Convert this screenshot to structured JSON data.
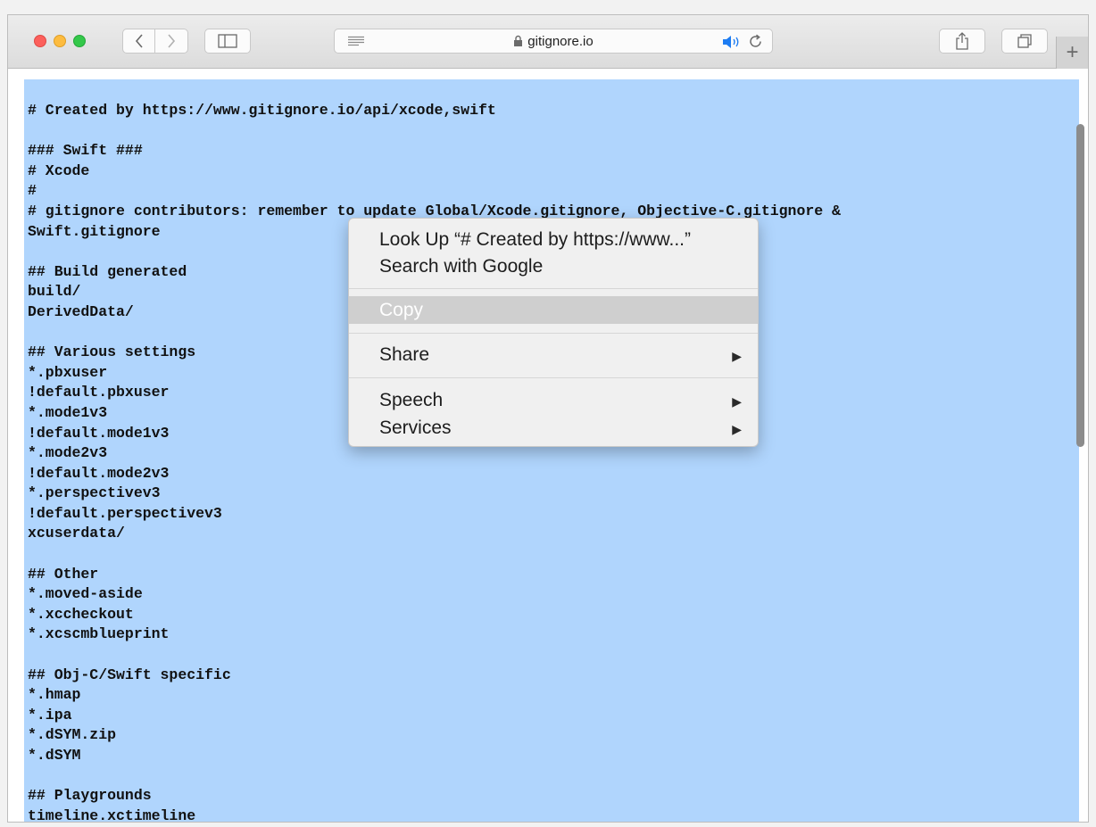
{
  "browser": {
    "address": {
      "domain": "gitignore.io"
    },
    "new_tab_label": "+"
  },
  "page": {
    "lines": [
      "# Created by https://www.gitignore.io/api/xcode,swift",
      "",
      "### Swift ###",
      "# Xcode",
      "#",
      "# gitignore contributors: remember to update Global/Xcode.gitignore, Objective-C.gitignore &",
      "Swift.gitignore",
      "",
      "## Build generated",
      "build/",
      "DerivedData/",
      "",
      "## Various settings",
      "*.pbxuser",
      "!default.pbxuser",
      "*.mode1v3",
      "!default.mode1v3",
      "*.mode2v3",
      "!default.mode2v3",
      "*.perspectivev3",
      "!default.perspectivev3",
      "xcuserdata/",
      "",
      "## Other",
      "*.moved-aside",
      "*.xccheckout",
      "*.xcscmblueprint",
      "",
      "## Obj-C/Swift specific",
      "*.hmap",
      "*.ipa",
      "*.dSYM.zip",
      "*.dSYM",
      "",
      "## Playgrounds",
      "timeline.xctimeline"
    ]
  },
  "context_menu": {
    "look_up": "Look Up “# Created by https://www...”",
    "search": "Search with Google",
    "copy": "Copy",
    "share": "Share",
    "speech": "Speech",
    "services": "Services",
    "submenu_arrow": "▶"
  },
  "colors": {
    "selection": "#b0d5fd",
    "menu_background": "#f0f0f0",
    "disabled_highlight": "#cfcfcf"
  }
}
